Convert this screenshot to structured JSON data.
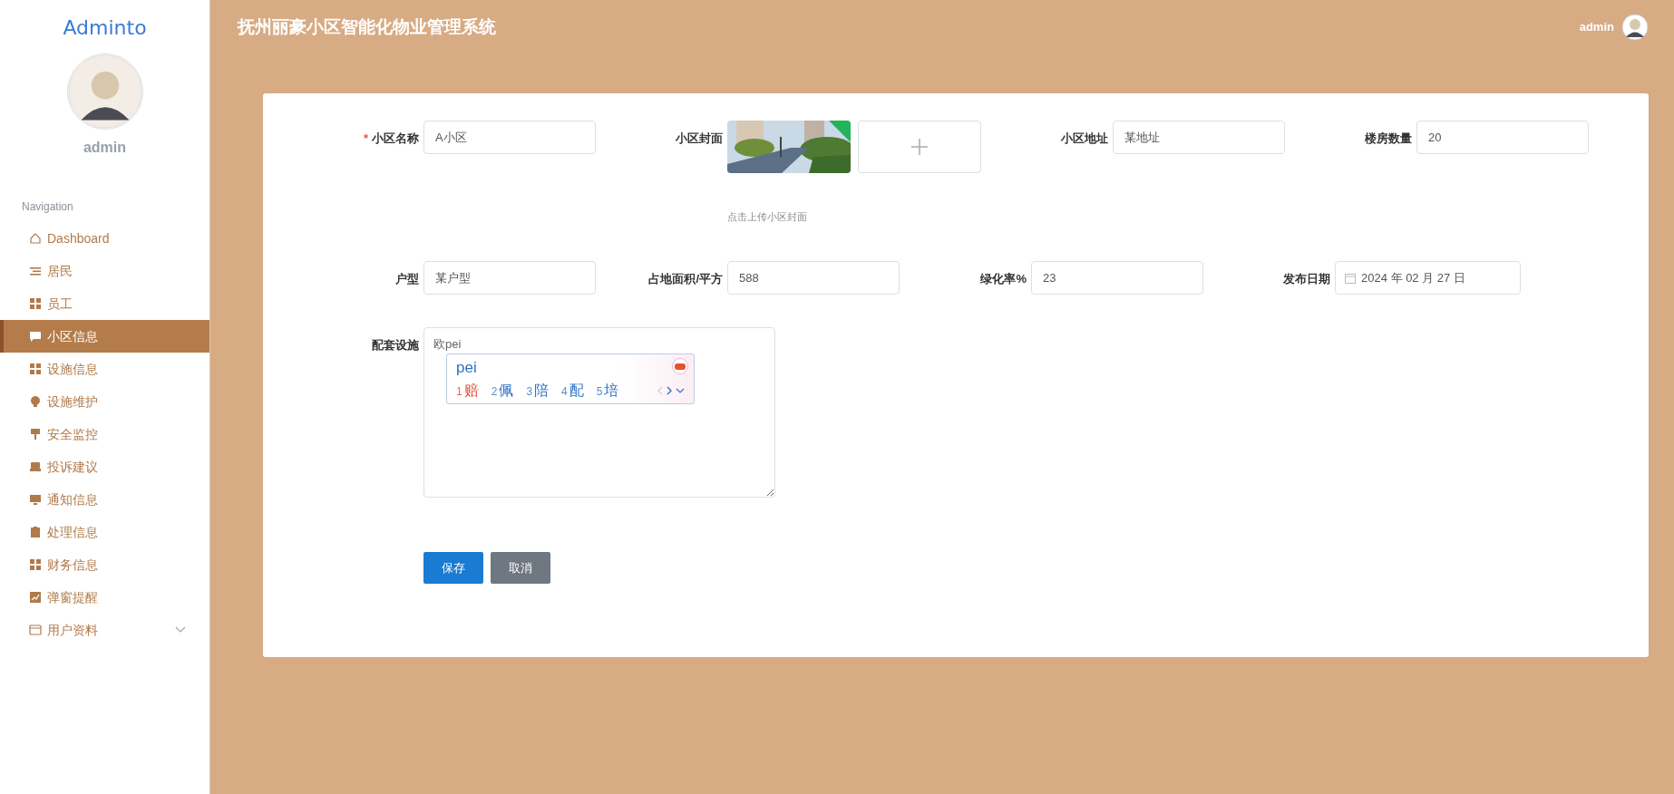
{
  "sidebar": {
    "logo": "Adminto",
    "user_name": "admin",
    "section_title": "Navigation",
    "items": [
      {
        "label": "Dashboard",
        "selected": false
      },
      {
        "label": "居民",
        "selected": false
      },
      {
        "label": "员工",
        "selected": false
      },
      {
        "label": "小区信息",
        "selected": true
      },
      {
        "label": "设施信息",
        "selected": false
      },
      {
        "label": "设施维护",
        "selected": false
      },
      {
        "label": "安全监控",
        "selected": false
      },
      {
        "label": "投诉建议",
        "selected": false
      },
      {
        "label": "通知信息",
        "selected": false
      },
      {
        "label": "处理信息",
        "selected": false
      },
      {
        "label": "财务信息",
        "selected": false
      },
      {
        "label": "弹窗提醒",
        "selected": false
      },
      {
        "label": "用户资料",
        "selected": false,
        "expanded": false
      }
    ]
  },
  "header": {
    "title": "抚州丽豪小区智能化物业管理系统",
    "user_name": "admin"
  },
  "form": {
    "rows": [
      [
        {
          "kind": "text",
          "label": "小区名称",
          "required_mark": "*",
          "value": "A小区"
        },
        {
          "kind": "upload",
          "label": "小区封面",
          "hint": "点击上传小区封面",
          "uploaded": true
        },
        {
          "kind": "text",
          "label": "小区地址",
          "value": "某地址"
        },
        {
          "kind": "text",
          "label": "楼房数量",
          "value": "20"
        }
      ],
      [
        {
          "kind": "text",
          "label": "户型",
          "value": "某户型"
        },
        {
          "kind": "text",
          "label": "占地面积/平方",
          "value": "588"
        },
        {
          "kind": "text",
          "label": "绿化率%",
          "value": "23"
        },
        {
          "kind": "date",
          "label": "发布日期",
          "value": "2024 年 02 月 27 日"
        }
      ],
      [
        {
          "kind": "textarea",
          "label": "配套设施",
          "value": "欧pei"
        }
      ]
    ],
    "buttons": [
      {
        "label": "保存",
        "kind": "primary"
      },
      {
        "label": "取消",
        "kind": "secondary"
      }
    ]
  },
  "ime_popup": {
    "input": "pei",
    "candidates": [
      {
        "number": "1",
        "text": "赔",
        "selected": true
      },
      {
        "number": "2",
        "text": "佩",
        "selected": false
      },
      {
        "number": "3",
        "text": "陪",
        "selected": false
      },
      {
        "number": "4",
        "text": "配",
        "selected": false
      },
      {
        "number": "5",
        "text": "培",
        "selected": false
      }
    ]
  }
}
